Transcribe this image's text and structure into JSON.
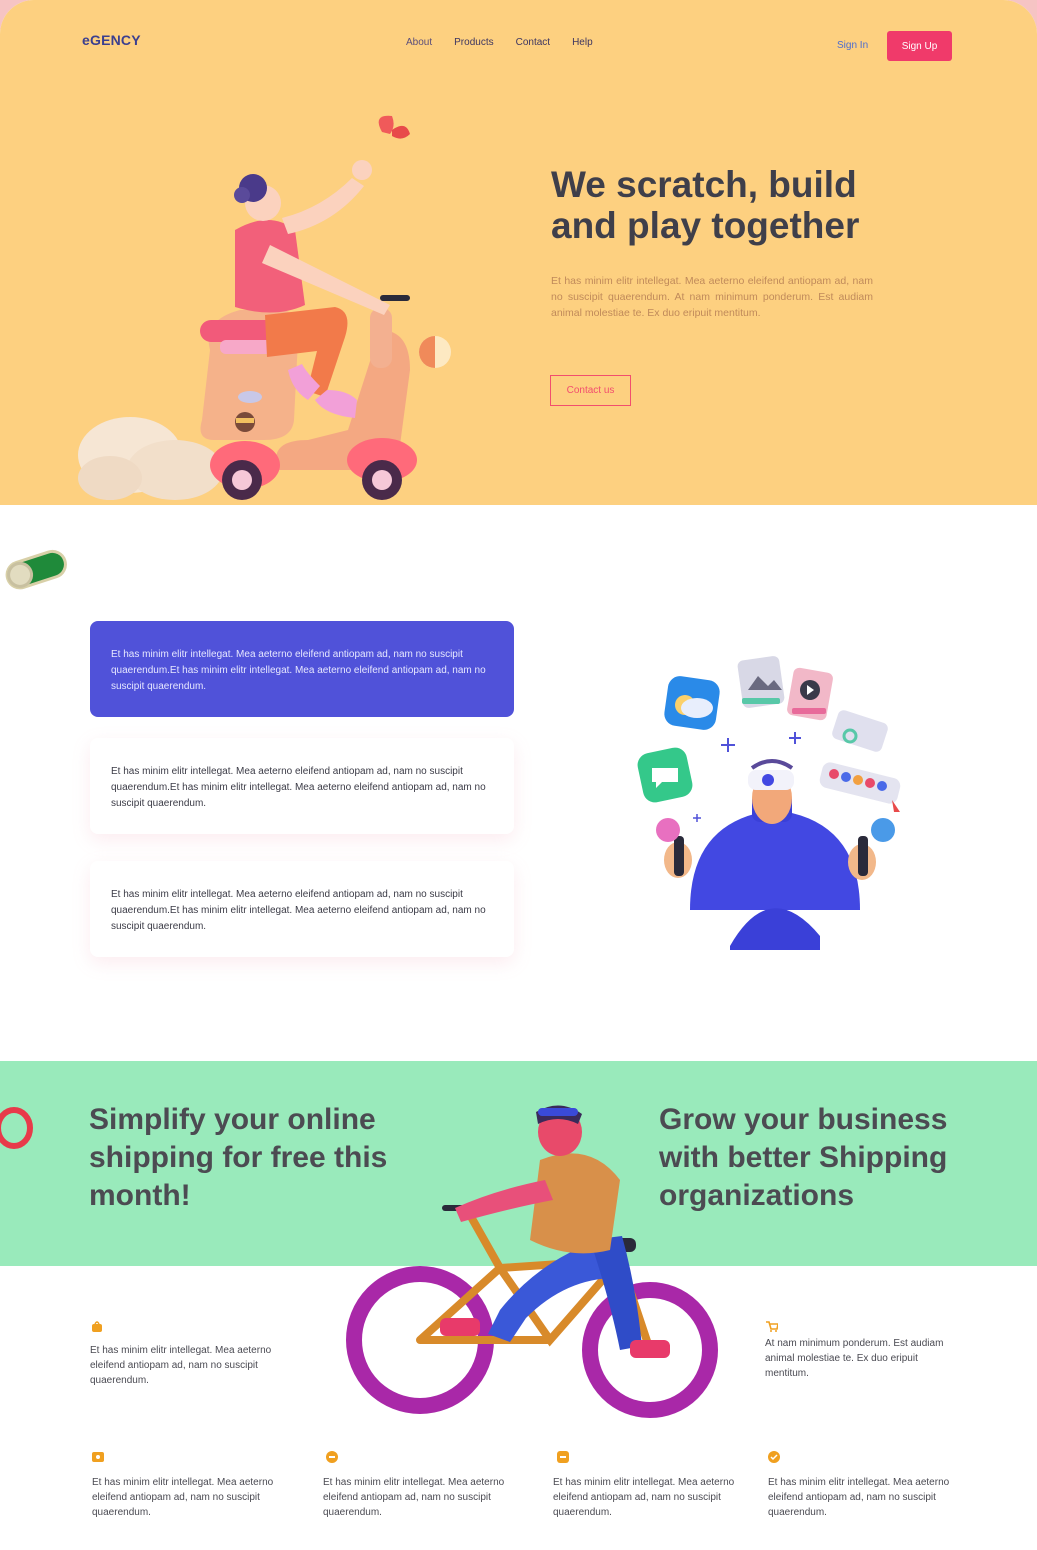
{
  "header": {
    "logo": "eGENCY",
    "nav": [
      "About",
      "Products",
      "Contact",
      "Help"
    ],
    "sign_in": "Sign In",
    "sign_up": "Sign Up"
  },
  "hero": {
    "title": "We scratch, build and play together",
    "text": "Et has minim elitr intellegat. Mea aeterno eleifend antiopam ad, nam no suscipit quaerendum. At nam minimum ponderum. Est audiam animal molestiae te. Ex duo eripuit mentitum.",
    "cta": "Contact us"
  },
  "features_cards": [
    "Et has minim elitr intellegat. Mea aeterno eleifend antiopam ad, nam no suscipit quaerendum.Et has minim elitr intellegat. Mea aeterno eleifend antiopam ad, nam no suscipit quaerendum.",
    "Et has minim elitr intellegat. Mea aeterno eleifend antiopam ad, nam no suscipit quaerendum.Et has minim elitr intellegat. Mea aeterno eleifend antiopam ad, nam no suscipit quaerendum.",
    "Et has minim elitr intellegat. Mea aeterno eleifend antiopam ad, nam no suscipit quaerendum.Et has minim elitr intellegat. Mea aeterno eleifend antiopam ad, nam no suscipit quaerendum."
  ],
  "shipping": {
    "left_heading": "Simplify your online shipping for free this month!",
    "right_heading": "Grow your business with better Shipping organizations",
    "items": [
      {
        "icon": "bag-icon",
        "text": "Et has minim elitr intellegat. Mea aeterno eleifend antiopam ad, nam no suscipit quaerendum."
      },
      {
        "icon": "cart-icon",
        "text": "At nam minimum ponderum. Est audiam animal molestiae te. Ex duo eripuit mentitum."
      },
      {
        "icon": "ticket-icon",
        "text": "Et has minim elitr intellegat. Mea aeterno eleifend antiopam ad, nam no suscipit quaerendum."
      },
      {
        "icon": "chat-icon",
        "text": "Et has minim elitr intellegat. Mea aeterno eleifend antiopam ad, nam no suscipit quaerendum."
      },
      {
        "icon": "box-icon",
        "text": "Et has minim elitr intellegat. Mea aeterno eleifend antiopam ad, nam no suscipit quaerendum."
      },
      {
        "icon": "badge-icon",
        "text": "Et has minim elitr intellegat. Mea aeterno eleifend antiopam ad, nam no suscipit quaerendum."
      }
    ]
  },
  "colors": {
    "hero_bg": "#fdd080",
    "accent_pink": "#f03a6a",
    "card_blue": "#5052d9",
    "green_band": "#99eabb",
    "icon_orange": "#f0a020"
  }
}
